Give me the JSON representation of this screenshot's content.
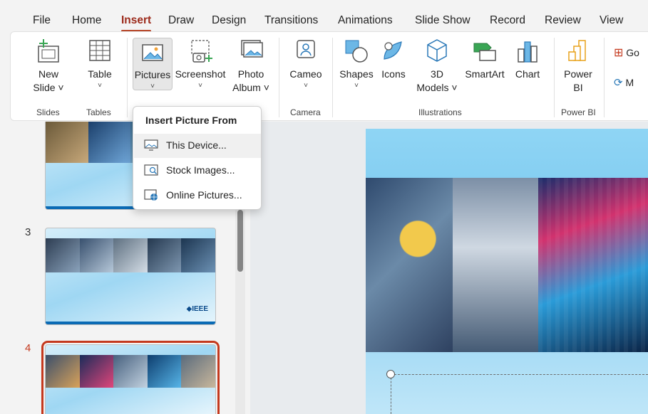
{
  "menubar": {
    "tabs": [
      {
        "label": "File"
      },
      {
        "label": "Home"
      },
      {
        "label": "Insert"
      },
      {
        "label": "Draw"
      },
      {
        "label": "Design"
      },
      {
        "label": "Transitions"
      },
      {
        "label": "Animations"
      },
      {
        "label": "Slide Show"
      },
      {
        "label": "Record"
      },
      {
        "label": "Review"
      },
      {
        "label": "View"
      }
    ],
    "active_tab": "Insert"
  },
  "ribbon": {
    "new_slide": {
      "line1": "New",
      "line2": "Slide ˅"
    },
    "table": {
      "label": "Table"
    },
    "pictures": {
      "label": "Pictures"
    },
    "screenshot": {
      "label": "Screenshot"
    },
    "photo_album": {
      "line1": "Photo",
      "line2": "Album ˅"
    },
    "cameo": {
      "label": "Cameo"
    },
    "shapes": {
      "label": "Shapes"
    },
    "icons": {
      "label": "Icons"
    },
    "models_3d": {
      "line1": "3D",
      "line2": "Models ˅"
    },
    "smartart": {
      "label": "SmartArt"
    },
    "chart": {
      "label": "Chart"
    },
    "power_bi": {
      "line1": "Power",
      "line2": "BI"
    },
    "cut_right_1": "Go",
    "cut_right_2": "M",
    "groups": {
      "slides": "Slides",
      "tables": "Tables",
      "camera": "Camera",
      "illustrations": "Illustrations",
      "power_bi": "Power BI"
    },
    "chevron": "˅"
  },
  "dropdown": {
    "header": "Insert Picture From",
    "items": [
      {
        "label": "This Device...",
        "icon": "device-picture-icon"
      },
      {
        "label": "Stock Images...",
        "icon": "stock-images-icon"
      },
      {
        "label": "Online Pictures...",
        "icon": "online-pictures-icon"
      }
    ]
  },
  "thumbnails": {
    "slide3": {
      "number": "3",
      "logo": "◆IEEE"
    },
    "slide4": {
      "number": "4"
    }
  },
  "colors": {
    "accent": "#b7472a",
    "active_slide": "#c4391e"
  }
}
